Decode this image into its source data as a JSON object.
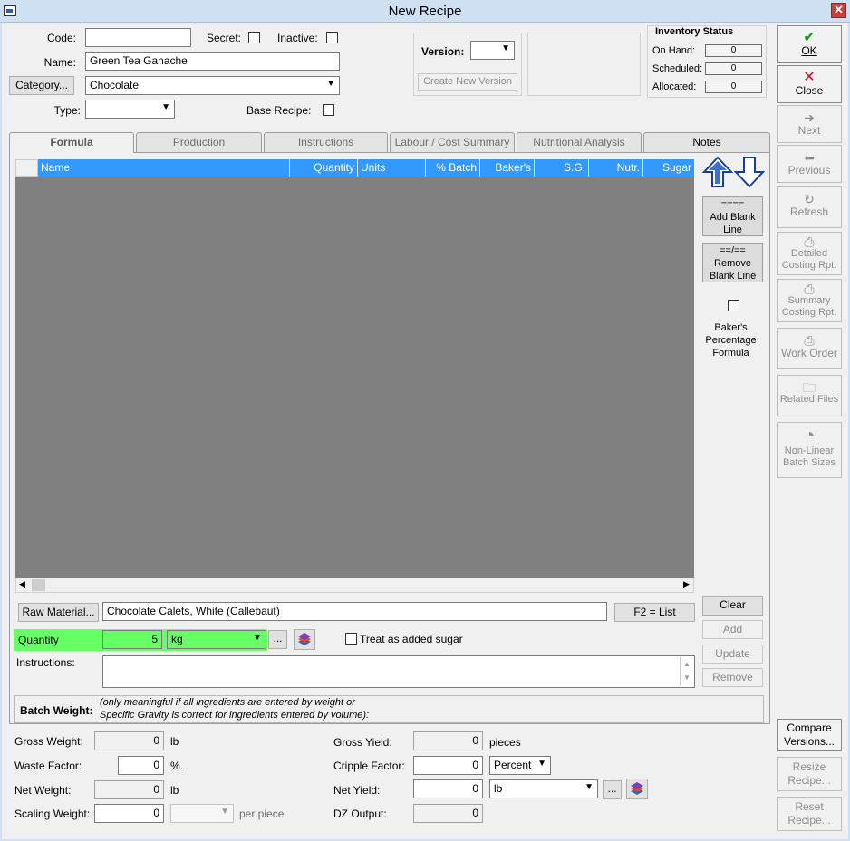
{
  "window": {
    "title": "New Recipe",
    "close_glyph": "✕"
  },
  "header": {
    "code_label": "Code:",
    "code_value": "",
    "secret_label": "Secret:",
    "inactive_label": "Inactive:",
    "name_label": "Name:",
    "name_value": "Green Tea Ganache",
    "category_button": "Category...",
    "category_value": "Chocolate",
    "type_label": "Type:",
    "type_value": "",
    "base_recipe_label": "Base Recipe:",
    "version_label": "Version:",
    "version_value": "",
    "create_version_button": "Create New Version"
  },
  "inventory": {
    "title": "Inventory Status",
    "rows": [
      {
        "label": "On Hand:",
        "value": "0"
      },
      {
        "label": "Scheduled:",
        "value": "0"
      },
      {
        "label": "Allocated:",
        "value": "0"
      }
    ]
  },
  "sidebar": {
    "ok": "OK",
    "close": "Close",
    "next": "Next",
    "previous": "Previous",
    "refresh": "Refresh",
    "detailed_1": "Detailed",
    "detailed_2": "Costing Rpt.",
    "summary_1": "Summary",
    "summary_2": "Costing Rpt.",
    "work_order": "Work Order",
    "related_files": "Related Files",
    "nonlinear_1": "Non-Linear",
    "nonlinear_2": "Batch Sizes",
    "compare_1": "Compare",
    "compare_2": "Versions...",
    "resize_1": "Resize",
    "resize_2": "Recipe...",
    "reset_1": "Reset",
    "reset_2": "Recipe..."
  },
  "tabs": [
    "Formula",
    "Production",
    "Instructions",
    "Labour / Cost Summary",
    "Nutritional Analysis",
    "Notes"
  ],
  "grid": {
    "columns": [
      "Name",
      "Quantity",
      "Units",
      "% Batch",
      "Baker's %",
      "S.G.",
      "Nutr.",
      "Sugar"
    ]
  },
  "grid_tools": {
    "add_blank_1": "====",
    "add_blank_2": "Add Blank",
    "add_blank_3": "Line",
    "remove_blank_1": "==/==",
    "remove_blank_2": "Remove",
    "remove_blank_3": "Blank Line",
    "bakers_1": "Baker's",
    "bakers_2": "Percentage",
    "bakers_3": "Formula"
  },
  "editor": {
    "raw_material_button": "Raw Material...",
    "raw_material_value": "Chocolate Calets, White (Callebaut)",
    "f2_list": "F2 = List",
    "clear": "Clear",
    "add": "Add",
    "update": "Update",
    "remove": "Remove",
    "quantity_label": "Quantity",
    "quantity_value": "5",
    "unit_value": "kg",
    "ellipsis": "...",
    "treat_sugar_label": "Treat as added sugar",
    "instructions_label": "Instructions:"
  },
  "batch": {
    "label": "Batch Weight:",
    "note_1": "(only meaningful if all ingredients are entered by weight or",
    "note_2": "Specific Gravity is correct for ingredients entered by volume):",
    "gross_weight_label": "Gross Weight:",
    "gross_weight_value": "0",
    "gross_weight_unit": "lb",
    "waste_factor_label": "Waste Factor:",
    "waste_factor_value": "0",
    "waste_factor_unit": "%.",
    "net_weight_label": "Net Weight:",
    "net_weight_value": "0",
    "net_weight_unit": "lb",
    "scaling_weight_label": "Scaling Weight:",
    "scaling_weight_value": "0",
    "per_piece": "per piece",
    "gross_yield_label": "Gross Yield:",
    "gross_yield_value": "0",
    "gross_yield_unit": "pieces",
    "cripple_factor_label": "Cripple Factor:",
    "cripple_factor_value": "0",
    "cripple_unit": "Percent",
    "net_yield_label": "Net Yield:",
    "net_yield_value": "0",
    "net_yield_unit": "lb",
    "dz_output_label": "DZ Output:",
    "dz_output_value": "0"
  },
  "colors": {
    "grid_header": "#3399ff",
    "grid_bg": "#808080",
    "quantity_highlight": "#66ff66"
  }
}
